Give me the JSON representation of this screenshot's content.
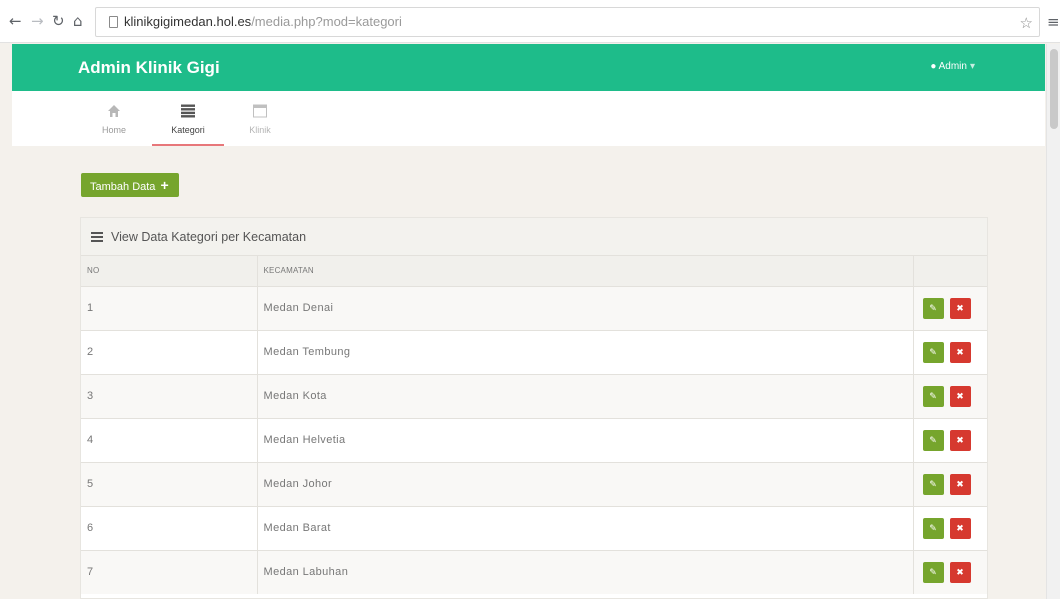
{
  "browser": {
    "url_host": "klinikgigimedan.hol.es",
    "url_path": "/media.php?mod=kategori"
  },
  "header": {
    "brand": "Admin Klinik Gigi",
    "user_label": "Admin",
    "accent_color": "#1ebc8a"
  },
  "nav": {
    "tabs": [
      {
        "label": "Home",
        "icon": "home-icon"
      },
      {
        "label": "Kategori",
        "icon": "list-icon",
        "active": true
      },
      {
        "label": "Klinik",
        "icon": "window-icon"
      }
    ]
  },
  "actions": {
    "add_label": "Tambah Data"
  },
  "panel": {
    "title": "View Data Kategori per Kecamatan",
    "columns": [
      "NO",
      "KECAMATAN",
      ""
    ]
  },
  "rows": [
    {
      "no": "1",
      "kecamatan": "Medan Denai"
    },
    {
      "no": "2",
      "kecamatan": "Medan Tembung"
    },
    {
      "no": "3",
      "kecamatan": "Medan Kota"
    },
    {
      "no": "4",
      "kecamatan": "Medan Helvetia"
    },
    {
      "no": "5",
      "kecamatan": "Medan Johor"
    },
    {
      "no": "6",
      "kecamatan": "Medan Barat"
    },
    {
      "no": "7",
      "kecamatan": "Medan Labuhan"
    }
  ],
  "colors": {
    "edit_button": "#76a52d",
    "delete_button": "#d6392f"
  }
}
